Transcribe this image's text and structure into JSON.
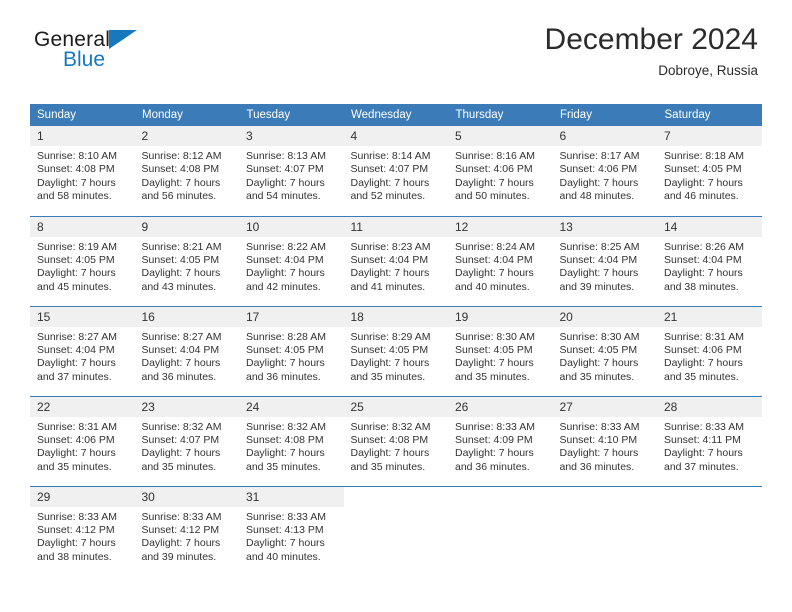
{
  "brand": {
    "name_part1": "General",
    "name_part2": "Blue",
    "logo_icon": "blue-triangle-icon",
    "accent_color": "#1878be"
  },
  "header": {
    "title": "December 2024",
    "location": "Dobroye, Russia"
  },
  "calendar": {
    "header_bg": "#3b7cb8",
    "daynum_bg": "#f0f0f0",
    "weekday_headers": [
      "Sunday",
      "Monday",
      "Tuesday",
      "Wednesday",
      "Thursday",
      "Friday",
      "Saturday"
    ],
    "labels": {
      "sunrise": "Sunrise:",
      "sunset": "Sunset:",
      "daylight": "Daylight:"
    },
    "weeks": [
      [
        {
          "day": "1",
          "sunrise": "Sunrise: 8:10 AM",
          "sunset": "Sunset: 4:08 PM",
          "daylight_line1": "Daylight: 7 hours",
          "daylight_line2": "and 58 minutes."
        },
        {
          "day": "2",
          "sunrise": "Sunrise: 8:12 AM",
          "sunset": "Sunset: 4:08 PM",
          "daylight_line1": "Daylight: 7 hours",
          "daylight_line2": "and 56 minutes."
        },
        {
          "day": "3",
          "sunrise": "Sunrise: 8:13 AM",
          "sunset": "Sunset: 4:07 PM",
          "daylight_line1": "Daylight: 7 hours",
          "daylight_line2": "and 54 minutes."
        },
        {
          "day": "4",
          "sunrise": "Sunrise: 8:14 AM",
          "sunset": "Sunset: 4:07 PM",
          "daylight_line1": "Daylight: 7 hours",
          "daylight_line2": "and 52 minutes."
        },
        {
          "day": "5",
          "sunrise": "Sunrise: 8:16 AM",
          "sunset": "Sunset: 4:06 PM",
          "daylight_line1": "Daylight: 7 hours",
          "daylight_line2": "and 50 minutes."
        },
        {
          "day": "6",
          "sunrise": "Sunrise: 8:17 AM",
          "sunset": "Sunset: 4:06 PM",
          "daylight_line1": "Daylight: 7 hours",
          "daylight_line2": "and 48 minutes."
        },
        {
          "day": "7",
          "sunrise": "Sunrise: 8:18 AM",
          "sunset": "Sunset: 4:05 PM",
          "daylight_line1": "Daylight: 7 hours",
          "daylight_line2": "and 46 minutes."
        }
      ],
      [
        {
          "day": "8",
          "sunrise": "Sunrise: 8:19 AM",
          "sunset": "Sunset: 4:05 PM",
          "daylight_line1": "Daylight: 7 hours",
          "daylight_line2": "and 45 minutes."
        },
        {
          "day": "9",
          "sunrise": "Sunrise: 8:21 AM",
          "sunset": "Sunset: 4:05 PM",
          "daylight_line1": "Daylight: 7 hours",
          "daylight_line2": "and 43 minutes."
        },
        {
          "day": "10",
          "sunrise": "Sunrise: 8:22 AM",
          "sunset": "Sunset: 4:04 PM",
          "daylight_line1": "Daylight: 7 hours",
          "daylight_line2": "and 42 minutes."
        },
        {
          "day": "11",
          "sunrise": "Sunrise: 8:23 AM",
          "sunset": "Sunset: 4:04 PM",
          "daylight_line1": "Daylight: 7 hours",
          "daylight_line2": "and 41 minutes."
        },
        {
          "day": "12",
          "sunrise": "Sunrise: 8:24 AM",
          "sunset": "Sunset: 4:04 PM",
          "daylight_line1": "Daylight: 7 hours",
          "daylight_line2": "and 40 minutes."
        },
        {
          "day": "13",
          "sunrise": "Sunrise: 8:25 AM",
          "sunset": "Sunset: 4:04 PM",
          "daylight_line1": "Daylight: 7 hours",
          "daylight_line2": "and 39 minutes."
        },
        {
          "day": "14",
          "sunrise": "Sunrise: 8:26 AM",
          "sunset": "Sunset: 4:04 PM",
          "daylight_line1": "Daylight: 7 hours",
          "daylight_line2": "and 38 minutes."
        }
      ],
      [
        {
          "day": "15",
          "sunrise": "Sunrise: 8:27 AM",
          "sunset": "Sunset: 4:04 PM",
          "daylight_line1": "Daylight: 7 hours",
          "daylight_line2": "and 37 minutes."
        },
        {
          "day": "16",
          "sunrise": "Sunrise: 8:27 AM",
          "sunset": "Sunset: 4:04 PM",
          "daylight_line1": "Daylight: 7 hours",
          "daylight_line2": "and 36 minutes."
        },
        {
          "day": "17",
          "sunrise": "Sunrise: 8:28 AM",
          "sunset": "Sunset: 4:05 PM",
          "daylight_line1": "Daylight: 7 hours",
          "daylight_line2": "and 36 minutes."
        },
        {
          "day": "18",
          "sunrise": "Sunrise: 8:29 AM",
          "sunset": "Sunset: 4:05 PM",
          "daylight_line1": "Daylight: 7 hours",
          "daylight_line2": "and 35 minutes."
        },
        {
          "day": "19",
          "sunrise": "Sunrise: 8:30 AM",
          "sunset": "Sunset: 4:05 PM",
          "daylight_line1": "Daylight: 7 hours",
          "daylight_line2": "and 35 minutes."
        },
        {
          "day": "20",
          "sunrise": "Sunrise: 8:30 AM",
          "sunset": "Sunset: 4:05 PM",
          "daylight_line1": "Daylight: 7 hours",
          "daylight_line2": "and 35 minutes."
        },
        {
          "day": "21",
          "sunrise": "Sunrise: 8:31 AM",
          "sunset": "Sunset: 4:06 PM",
          "daylight_line1": "Daylight: 7 hours",
          "daylight_line2": "and 35 minutes."
        }
      ],
      [
        {
          "day": "22",
          "sunrise": "Sunrise: 8:31 AM",
          "sunset": "Sunset: 4:06 PM",
          "daylight_line1": "Daylight: 7 hours",
          "daylight_line2": "and 35 minutes."
        },
        {
          "day": "23",
          "sunrise": "Sunrise: 8:32 AM",
          "sunset": "Sunset: 4:07 PM",
          "daylight_line1": "Daylight: 7 hours",
          "daylight_line2": "and 35 minutes."
        },
        {
          "day": "24",
          "sunrise": "Sunrise: 8:32 AM",
          "sunset": "Sunset: 4:08 PM",
          "daylight_line1": "Daylight: 7 hours",
          "daylight_line2": "and 35 minutes."
        },
        {
          "day": "25",
          "sunrise": "Sunrise: 8:32 AM",
          "sunset": "Sunset: 4:08 PM",
          "daylight_line1": "Daylight: 7 hours",
          "daylight_line2": "and 35 minutes."
        },
        {
          "day": "26",
          "sunrise": "Sunrise: 8:33 AM",
          "sunset": "Sunset: 4:09 PM",
          "daylight_line1": "Daylight: 7 hours",
          "daylight_line2": "and 36 minutes."
        },
        {
          "day": "27",
          "sunrise": "Sunrise: 8:33 AM",
          "sunset": "Sunset: 4:10 PM",
          "daylight_line1": "Daylight: 7 hours",
          "daylight_line2": "and 36 minutes."
        },
        {
          "day": "28",
          "sunrise": "Sunrise: 8:33 AM",
          "sunset": "Sunset: 4:11 PM",
          "daylight_line1": "Daylight: 7 hours",
          "daylight_line2": "and 37 minutes."
        }
      ],
      [
        {
          "day": "29",
          "sunrise": "Sunrise: 8:33 AM",
          "sunset": "Sunset: 4:12 PM",
          "daylight_line1": "Daylight: 7 hours",
          "daylight_line2": "and 38 minutes."
        },
        {
          "day": "30",
          "sunrise": "Sunrise: 8:33 AM",
          "sunset": "Sunset: 4:12 PM",
          "daylight_line1": "Daylight: 7 hours",
          "daylight_line2": "and 39 minutes."
        },
        {
          "day": "31",
          "sunrise": "Sunrise: 8:33 AM",
          "sunset": "Sunset: 4:13 PM",
          "daylight_line1": "Daylight: 7 hours",
          "daylight_line2": "and 40 minutes."
        },
        {
          "day": "",
          "sunrise": "",
          "sunset": "",
          "daylight_line1": "",
          "daylight_line2": ""
        },
        {
          "day": "",
          "sunrise": "",
          "sunset": "",
          "daylight_line1": "",
          "daylight_line2": ""
        },
        {
          "day": "",
          "sunrise": "",
          "sunset": "",
          "daylight_line1": "",
          "daylight_line2": ""
        },
        {
          "day": "",
          "sunrise": "",
          "sunset": "",
          "daylight_line1": "",
          "daylight_line2": ""
        }
      ]
    ]
  }
}
